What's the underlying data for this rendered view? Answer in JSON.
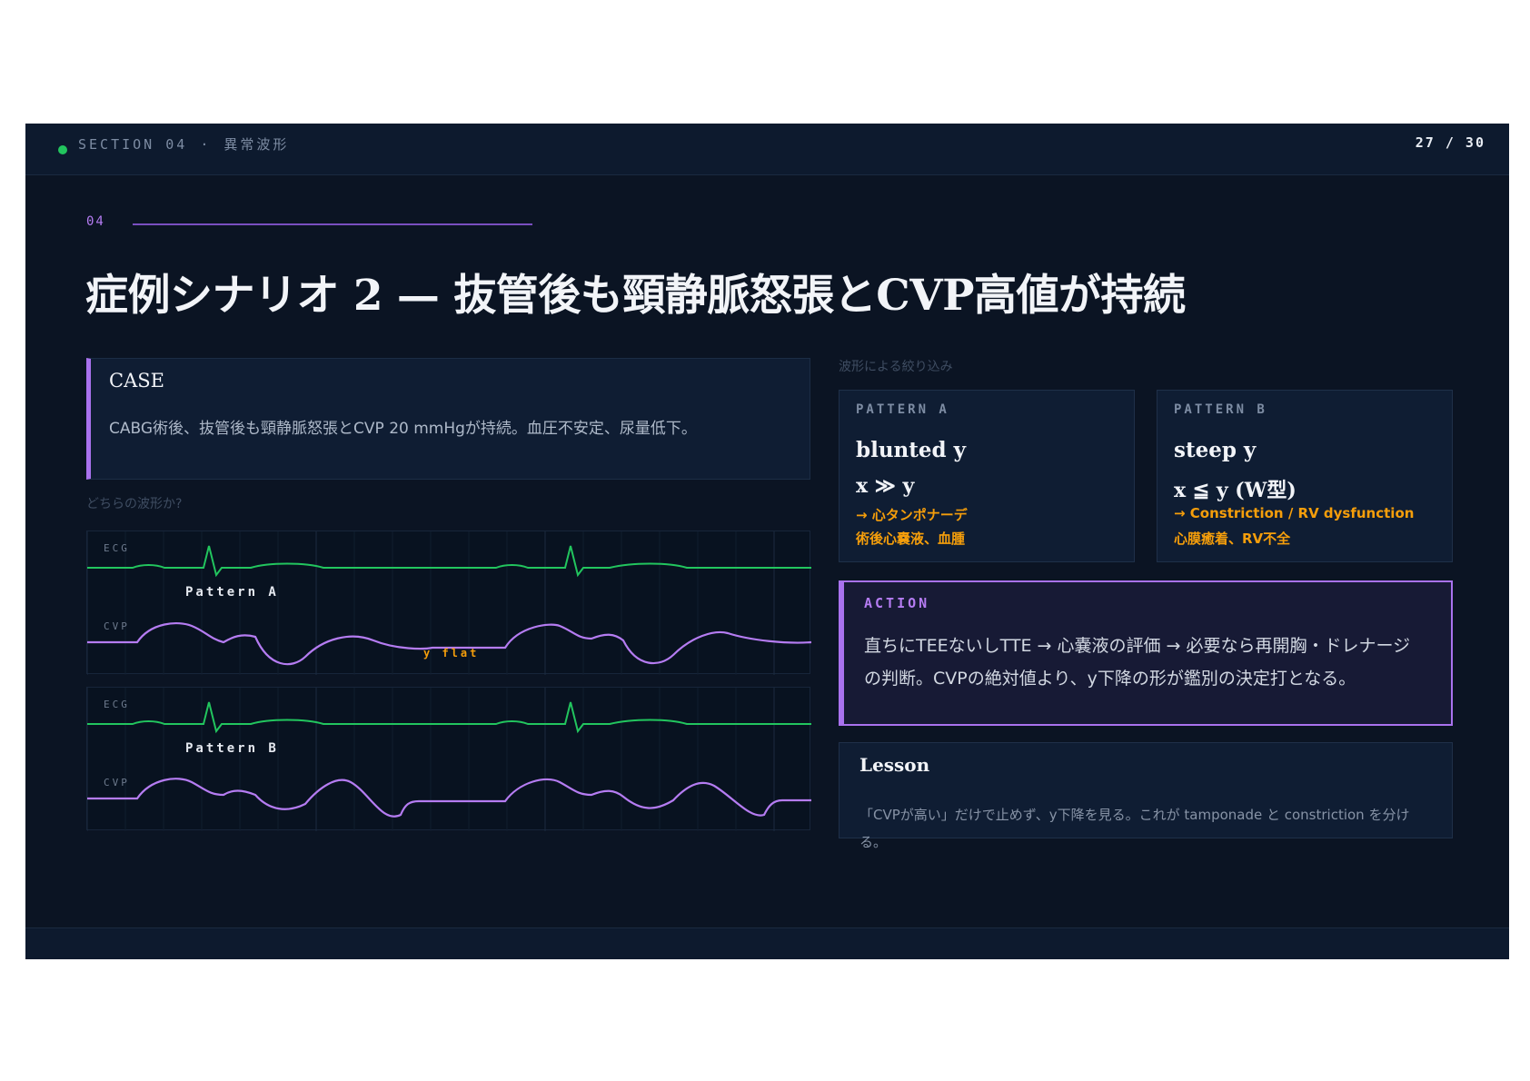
{
  "header": {
    "section_label": "SECTION 04",
    "separator": "·",
    "section_name": "異常波形",
    "page_indicator": "27 / 30"
  },
  "section_number": "04",
  "title": "症例シナリオ 2 — 抜管後も頸静脈怒張とCVP高値が持続",
  "case": {
    "heading": "CASE",
    "text": "CABG術後、抜管後も頸静脈怒張とCVP 20 mmHgが持続。血圧不安定、尿量低下。"
  },
  "question_label": "どちらの波形か?",
  "waveforms": [
    {
      "ecg_label": "ECG",
      "cvp_label": "CVP",
      "pattern_label": "Pattern A",
      "annotation": "y flat"
    },
    {
      "ecg_label": "ECG",
      "cvp_label": "CVP",
      "pattern_label": "Pattern B",
      "annotation": ""
    }
  ],
  "narrowing_label": "波形による絞り込み",
  "patterns": [
    {
      "header": "PATTERN A",
      "title": "blunted y",
      "formula": "x ≫ y",
      "diagnosis": "→ 心タンポナーデ",
      "causes": "術後心嚢液、血腫"
    },
    {
      "header": "PATTERN B",
      "title": "steep y",
      "formula": "x ≦ y (W型)",
      "diagnosis": "→ Constriction / RV dysfunction",
      "causes": "心膜癒着、RV不全"
    }
  ],
  "action": {
    "heading": "ACTION",
    "text": "直ちにTEEないしTTE → 心嚢液の評価 → 必要なら再開胸・ドレナージの判断。CVPの絶対値より、y下降の形が鑑別の決定打となる。"
  },
  "lesson": {
    "heading": "Lesson",
    "text": "「CVPが高い」だけで止めず、y下降を見る。これが tamponade と constriction を分ける。"
  },
  "colors": {
    "background": "#0b1423",
    "accent_purple": "#a972ee",
    "ecg_green": "#22c55e",
    "warning_amber": "#f59e0b",
    "status_dot": "#22c55e"
  }
}
